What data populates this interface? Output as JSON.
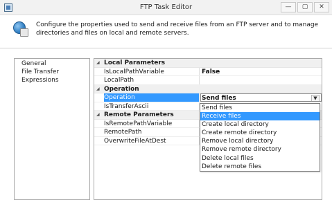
{
  "window": {
    "title": "FTP Task Editor",
    "buttons": [
      "—",
      "▢",
      "✕"
    ]
  },
  "header": {
    "description": "Configure the properties used to send and receive files from an FTP server and to manage directories and files on local and remote servers."
  },
  "nav": {
    "items": [
      {
        "label": "General"
      },
      {
        "label": "File Transfer"
      },
      {
        "label": "Expressions"
      }
    ]
  },
  "grid": {
    "local": {
      "category": "Local Parameters",
      "is_local_path_variable": {
        "name": "IsLocalPathVariable",
        "value": "False"
      },
      "local_path": {
        "name": "LocalPath",
        "value": ""
      }
    },
    "operation": {
      "category": "Operation",
      "operation": {
        "name": "Operation",
        "value": "Send files"
      },
      "is_transfer_ascii": {
        "name": "IsTransferAscii",
        "value": ""
      }
    },
    "remote": {
      "category": "Remote Parameters",
      "is_remote_path_variable": {
        "name": "IsRemotePathVariable",
        "value": ""
      },
      "remote_path": {
        "name": "RemotePath",
        "value": ""
      },
      "overwrite_file_at_dest": {
        "name": "OverwriteFileAtDest",
        "value": ""
      }
    }
  },
  "dropdown": {
    "selected": "Send files",
    "highlighted": "Receive files",
    "options": [
      "Send files",
      "Receive files",
      "Create local directory",
      "Create remote directory",
      "Remove local directory",
      "Remove remote directory",
      "Delete local files",
      "Delete remote files"
    ]
  },
  "icons": {
    "app": "ssis-task-icon",
    "header": "ftp-globe-icon",
    "dropdown_arrow": "chevron-down-icon"
  },
  "colors": {
    "selection": "#3399ff",
    "category_bg": "#f0f0f0"
  }
}
